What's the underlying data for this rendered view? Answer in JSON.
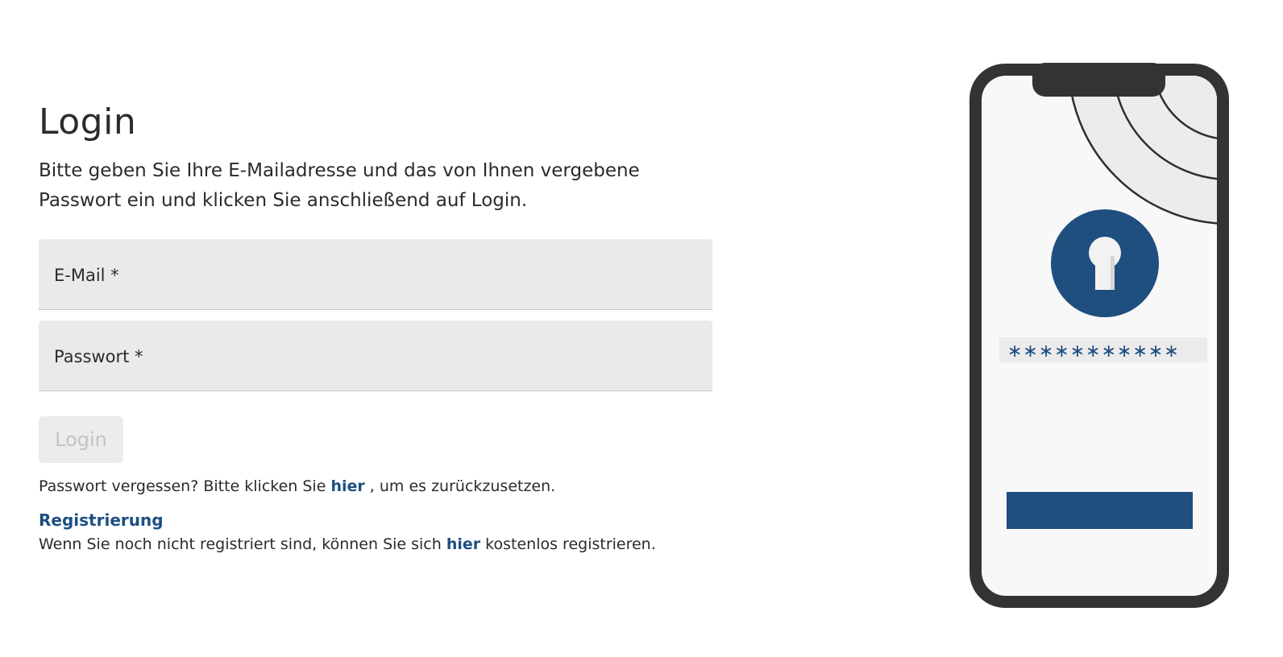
{
  "login": {
    "title": "Login",
    "intro": "Bitte geben Sie Ihre E-Mailadresse und das von Ihnen vergebene Passwort ein und klicken Sie anschließend auf Login.",
    "email_label": "E-Mail *",
    "email_value": "",
    "password_label": "Passwort *",
    "password_value": "",
    "button_label": "Login",
    "forgot_prefix": "Passwort vergessen? Bitte klicken Sie ",
    "forgot_link": "hier",
    "forgot_suffix": " , um es zurückzusetzen."
  },
  "registration": {
    "heading": "Registrierung",
    "prefix": "Wenn Sie noch nicht registriert sind, können Sie sich ",
    "link": "hier",
    "suffix": " kostenlos registrieren."
  },
  "illustration": {
    "masked_password": "∗∗∗∗∗∗∗∗∗∗∗",
    "icons": [
      "phone-illustration",
      "keyhole-lock-icon"
    ],
    "colors": {
      "accent": "#1f4f7e",
      "phone_frame": "#333333",
      "screen": "#f8f8f8",
      "input_bg": "#ebebeb"
    }
  },
  "theme": {
    "text": "#2b2b2b",
    "link": "#1d4f7f",
    "field_bg": "#eaeaea",
    "button_disabled_bg": "#ececec",
    "button_disabled_text": "#c3c3c3"
  }
}
